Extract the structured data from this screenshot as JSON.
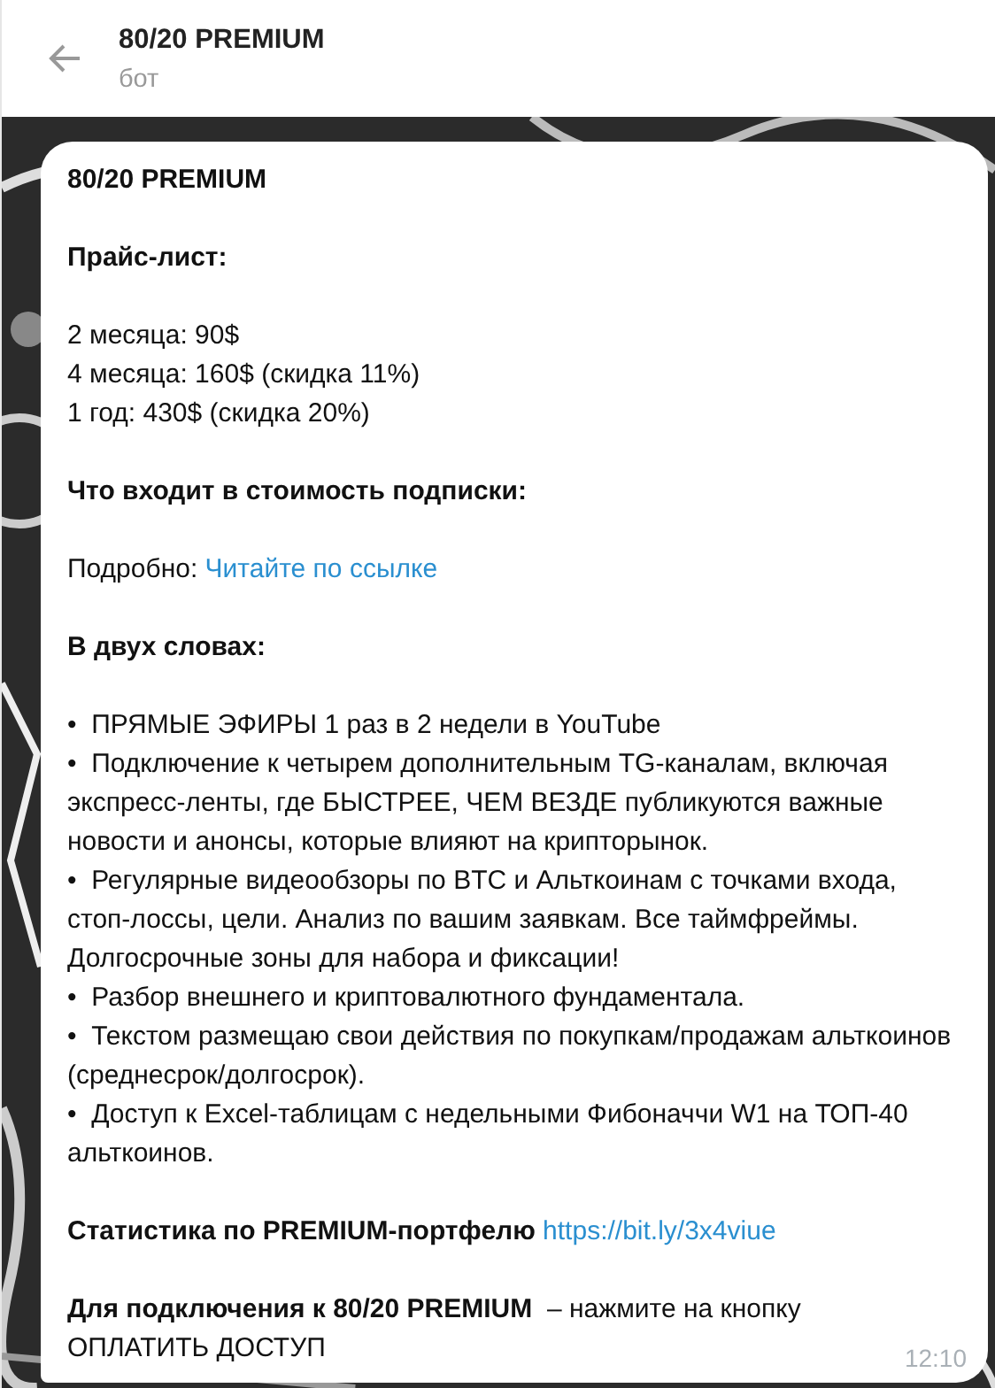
{
  "header": {
    "title": "80/20 PREMIUM",
    "subtitle": "бот"
  },
  "message": {
    "blocks": [
      {
        "kind": "heading",
        "text": "80/20 PREMIUM"
      },
      {
        "kind": "heading",
        "text": "Прайс-лист:"
      },
      {
        "kind": "lines",
        "lines": [
          "2 месяца: 90$",
          "4 месяца: 160$ (скидка 11%)",
          "1 год: 430$ (скидка 20%)"
        ]
      },
      {
        "kind": "heading",
        "text": "Что входит в стоимость подписки:"
      },
      {
        "kind": "link_line",
        "text": "Подробно:",
        "link": "Читайте по ссылке",
        "bold": false
      },
      {
        "kind": "heading",
        "text": "В двух словах:"
      },
      {
        "kind": "lines",
        "lines": [
          "•  ПРЯМЫЕ ЭФИРЫ 1 раз в 2 недели в YouTube",
          "•  Подключение к четырем дополнительным TG-каналам, включая экспресс-ленты, где БЫСТРЕЕ, ЧЕМ ВЕЗДЕ публикуются важные новости и анонсы, которые влияют на крипторынок.",
          "•  Регулярные видеообзоры по BTC и Альткоинам с точками входа, стоп-лоссы, цели. Анализ по вашим заявкам. Все таймфреймы. Долгосрочные зоны для набора и фиксации!",
          "•  Разбор внешнего и криптовалютного фундаментала.",
          "•  Текстом размещаю свои действия по покупкам/продажам альткоинов (среднесрок/долгосрок).",
          "•  Доступ к Excel-таблицам с недельными Фибоначчи W1 на ТОП-40 альткоинов."
        ]
      },
      {
        "kind": "link_line",
        "text": "Статистика по PREMIUM-портфелю",
        "link": "https://bit.ly/3x4viue",
        "bold": true
      },
      {
        "kind": "paragraph",
        "text": "**Для подключения к 80/20 PREMIUM**  – нажмите на кнопку ОПЛАТИТЬ ДОСТУП"
      }
    ],
    "time": "12:10"
  }
}
